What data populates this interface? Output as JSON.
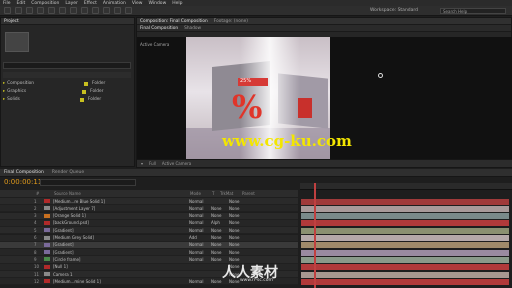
{
  "menu": [
    "File",
    "Edit",
    "Composition",
    "Layer",
    "Effect",
    "Animation",
    "View",
    "Window",
    "Help"
  ],
  "workspace": {
    "label": "Workspace:",
    "value": "Standard"
  },
  "search_help": "Search Help",
  "project": {
    "tab": "Project",
    "items": [
      {
        "name": "Composition",
        "label": "Folder",
        "color": "#c8c020"
      },
      {
        "name": "Graphics",
        "label": "Folder",
        "color": "#c8c020"
      },
      {
        "name": "Solids",
        "label": "Folder",
        "color": "#c8c020"
      }
    ]
  },
  "viewer": {
    "tabs": [
      "Composition: Final Composition",
      "Footage: (none)"
    ],
    "subtabs": [
      "Final Composition",
      "Shadow"
    ],
    "camera_label": "Active Camera",
    "percent_text": "%",
    "tag_text": "25%",
    "zoom": "Full",
    "watermark": "www.cg-ku.com"
  },
  "timeline": {
    "tabs": [
      "Final Composition",
      "Render Queue"
    ],
    "timecode": "0:00:00:11",
    "columns": [
      "#",
      "Source Name",
      "Mode",
      "T",
      "TrkMat",
      "Parent"
    ],
    "layers": [
      {
        "num": "1",
        "name": "[Medium...re Blue Solid 1]",
        "mode": "Normal",
        "trk": "",
        "parent": "None",
        "color": "#b02a2a"
      },
      {
        "num": "2",
        "name": "[Adjustment Layer 7]",
        "mode": "Normal",
        "trk": "None",
        "parent": "None",
        "color": "#8a8a8a"
      },
      {
        "num": "3",
        "name": "[Orange Solid 1]",
        "mode": "Normal",
        "trk": "None",
        "parent": "None",
        "color": "#c87020"
      },
      {
        "num": "4",
        "name": "[backGround.psd]",
        "mode": "Normal",
        "trk": "Alph",
        "parent": "None",
        "color": "#b02a2a"
      },
      {
        "num": "5",
        "name": "[Gradient]",
        "mode": "Normal",
        "trk": "None",
        "parent": "None",
        "color": "#7a6a9a"
      },
      {
        "num": "6",
        "name": "[Medium Grey Solid]",
        "mode": "Add",
        "trk": "None",
        "parent": "None",
        "color": "#8a8a8a"
      },
      {
        "num": "7",
        "name": "[Gradient]",
        "mode": "Normal",
        "trk": "None",
        "parent": "None",
        "color": "#7a6a9a"
      },
      {
        "num": "8",
        "name": "[Gradient]",
        "mode": "Normal",
        "trk": "None",
        "parent": "None",
        "color": "#7a6a9a"
      },
      {
        "num": "9",
        "name": "[Circle frame]",
        "mode": "Normal",
        "trk": "None",
        "parent": "None",
        "color": "#4a8a4a"
      },
      {
        "num": "10",
        "name": "[Null 1]",
        "mode": "",
        "trk": "",
        "parent": "None",
        "color": "#b02a2a"
      },
      {
        "num": "11",
        "name": "Camera 1",
        "mode": "",
        "trk": "",
        "parent": "None",
        "color": "#8a8a8a"
      },
      {
        "num": "12",
        "name": "[Medium...mine Solid 1]",
        "mode": "Normal",
        "trk": "None",
        "parent": "None",
        "color": "#b02a2a"
      }
    ]
  },
  "bar_colors": [
    "#a03a3a",
    "#a89a9a",
    "#7a8a8a",
    "#b03a3a",
    "#8a9070",
    "#b4a8a8",
    "#a08a6a",
    "#9a8aa0",
    "#8a9a8a",
    "#b03a3a",
    "#a89890",
    "#b03a3a"
  ],
  "watermark_bottom": {
    "big": "人人素材",
    "small": "www.rr-sc.com"
  }
}
